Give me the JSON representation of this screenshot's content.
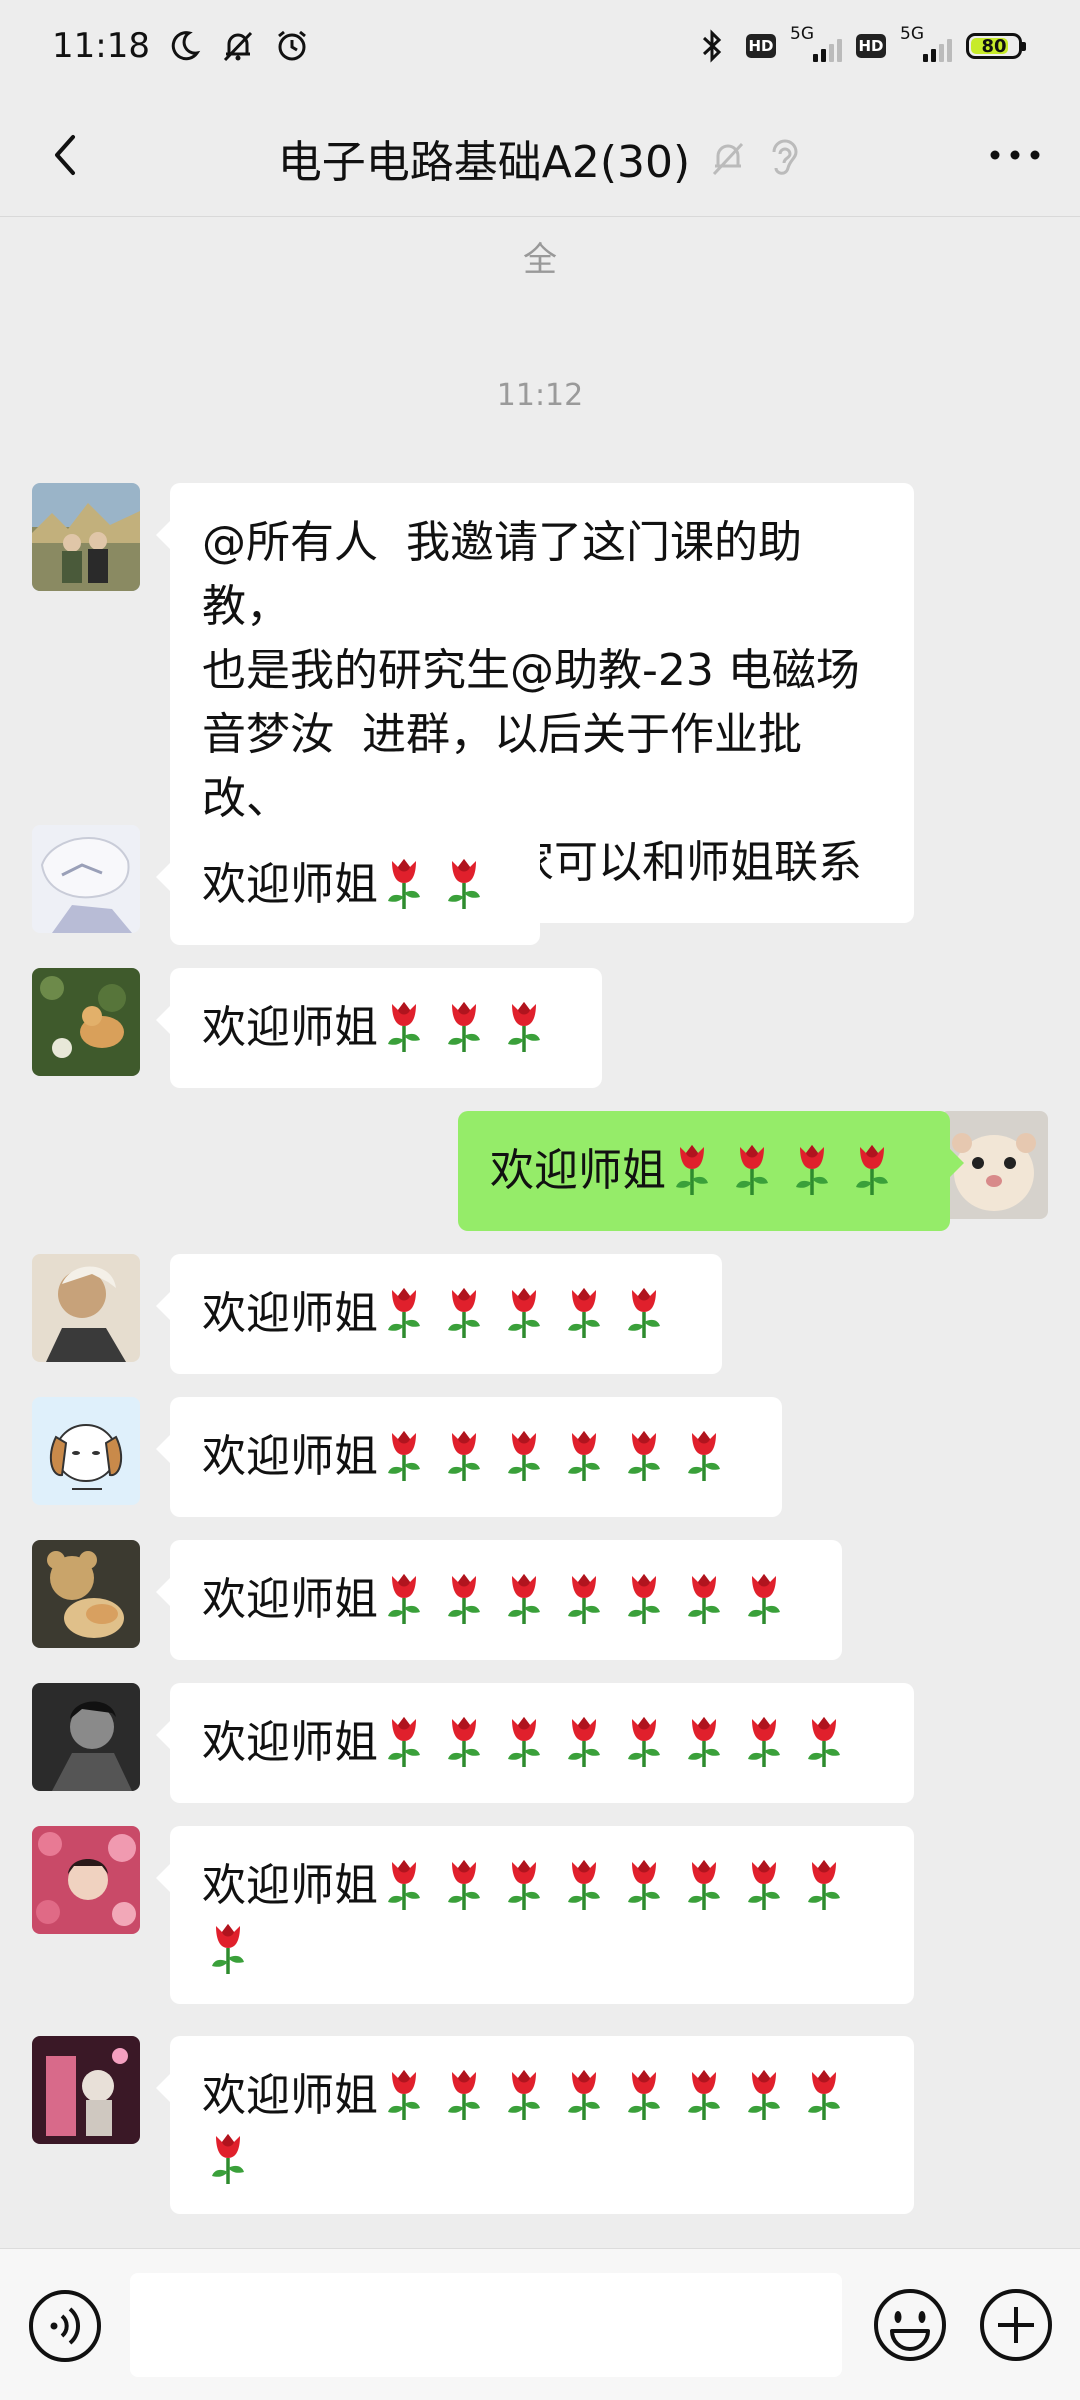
{
  "status_bar": {
    "time": "11:18",
    "battery": "80",
    "battery_level": 0.8,
    "network_1": "5G",
    "network_2": "5G",
    "hd_1": "HD",
    "hd_2": "HD",
    "icons": [
      "moon-icon",
      "bell-off-icon",
      "alarm-icon",
      "bluetooth-icon"
    ]
  },
  "header": {
    "title": "电子电路基础A2(30)",
    "icons": [
      "back-icon",
      "mute-icon",
      "ear-icon",
      "more-icon"
    ]
  },
  "chat": {
    "system_text": "全",
    "timestamp": "11:12",
    "messages": [
      {
        "text": "@所有人  我邀请了这门课的助教，\n也是我的研究生@助教-23 电磁场\n音梦汝  进群，以后关于作业批改、\n补交等问题，大家可以和师姐联系",
        "roses": 0,
        "self": false
      },
      {
        "text": "欢迎师姐",
        "roses": 2,
        "self": false
      },
      {
        "text": "欢迎师姐",
        "roses": 3,
        "self": false
      },
      {
        "text": "欢迎师姐",
        "roses": 4,
        "self": true
      },
      {
        "text": "欢迎师姐",
        "roses": 5,
        "self": false
      },
      {
        "text": "欢迎师姐",
        "roses": 6,
        "self": false
      },
      {
        "text": "欢迎师姐",
        "roses": 7,
        "self": false
      },
      {
        "text": "欢迎师姐",
        "roses": 8,
        "self": false
      },
      {
        "text": "欢迎师姐",
        "roses": 9,
        "self": false
      },
      {
        "text": "欢迎师姐",
        "roses": 9,
        "self": false
      }
    ]
  },
  "input_bar": {
    "input_value": "",
    "icons": [
      "voice-icon",
      "emoji-icon",
      "plus-icon"
    ]
  },
  "colors": {
    "background": "#ededed",
    "bubble_other": "#ffffff",
    "bubble_self": "#95ec69",
    "text": "#111111",
    "timestamp": "#9a9a9a"
  }
}
